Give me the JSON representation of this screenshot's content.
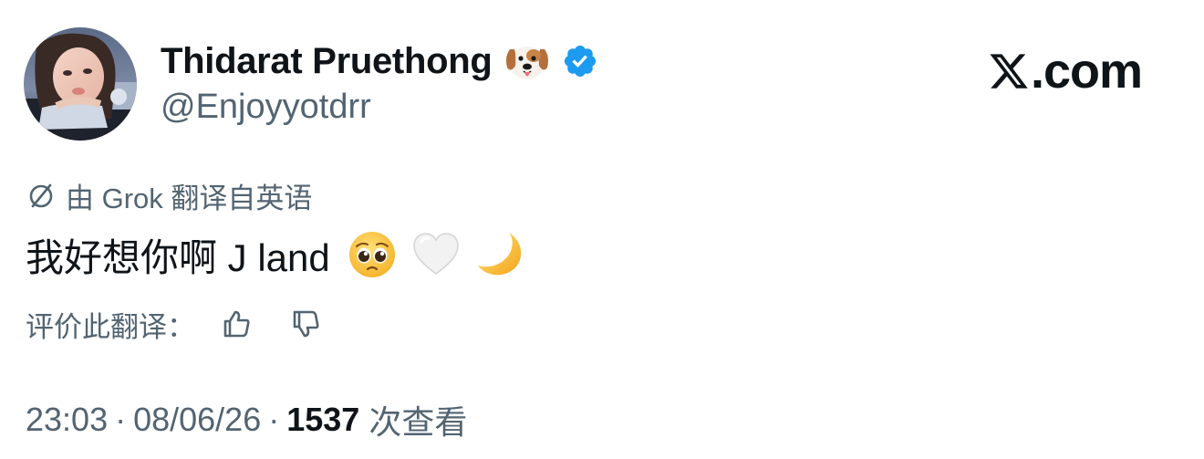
{
  "author": {
    "display_name": "Thidarat Pruethong",
    "handle": "@Enjoyyotdrr",
    "name_emoji": "dog-face-icon",
    "verified": true,
    "verified_color": "#1d9bf0"
  },
  "brand": {
    "text": ".com",
    "logo": "x-logo-icon"
  },
  "translation": {
    "label": "由 Grok 翻译自英语",
    "icon": "translate-icon"
  },
  "tweet": {
    "text": "我好想你啊 J land",
    "emojis": [
      "pleading-face-icon",
      "white-heart-icon",
      "crescent-moon-icon"
    ]
  },
  "rating": {
    "label": "评价此翻译：",
    "thumbs_up_icon": "thumbs-up-icon",
    "thumbs_down_icon": "thumbs-down-icon"
  },
  "meta": {
    "time": "23:03",
    "separator": "·",
    "date": "08/06/26",
    "views_count": "1537",
    "views_label": "次查看"
  },
  "colors": {
    "text_primary": "#0f1419",
    "text_secondary": "#536471",
    "verified_blue": "#1d9bf0"
  }
}
